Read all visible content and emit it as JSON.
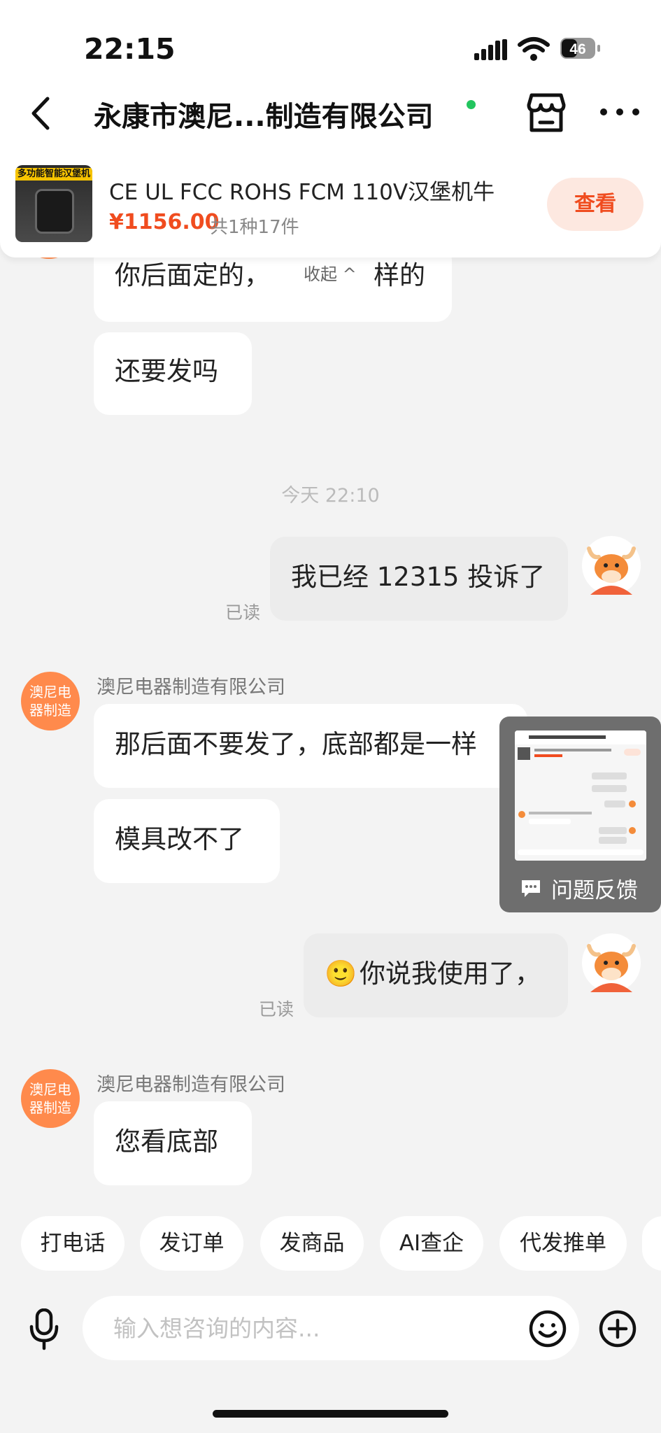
{
  "status_bar": {
    "time": "22:15",
    "battery": "46"
  },
  "header": {
    "title": "永康市澳尼...制造有限公司",
    "online_color": "#22c55e"
  },
  "product": {
    "thumb_banner": "多功能智能汉堡机",
    "name": "CE UL FCC ROHS FCM 110V汉堡机牛",
    "price": "¥1156.00",
    "quantity": "共1种17件",
    "view_label": "查看"
  },
  "messages": [
    {
      "side": "in",
      "text": "你后面定的，",
      "text2": "样的",
      "collapse_label": "收起 ^"
    },
    {
      "side": "in",
      "text": "还要发吗"
    },
    {
      "timestamp": "今天 22:10"
    },
    {
      "side": "out",
      "text": "我已经 12315 投诉了",
      "status": "已读"
    },
    {
      "side": "in",
      "sender": "澳尼电器制造有限公司",
      "avatar_text": "澳尼电器制造",
      "text": "那后面不要发了，底部都是一样"
    },
    {
      "side": "in",
      "text": "模具改不了"
    },
    {
      "side": "out",
      "text": "你说我使用了，",
      "emoji": "🙂",
      "status": "已读"
    },
    {
      "side": "in",
      "sender": "澳尼电器制造有限公司",
      "avatar_text": "澳尼电器制造",
      "text": "您看底部"
    }
  ],
  "feedback": {
    "label": "问题反馈"
  },
  "quick_actions": [
    "打电话",
    "发订单",
    "发商品",
    "AI查企",
    "代发推单"
  ],
  "input": {
    "placeholder": "输入想咨询的内容..."
  },
  "colors": {
    "accent": "#f04c1f",
    "shop_avatar": "#ff8a4c",
    "background": "#f3f3f3"
  }
}
